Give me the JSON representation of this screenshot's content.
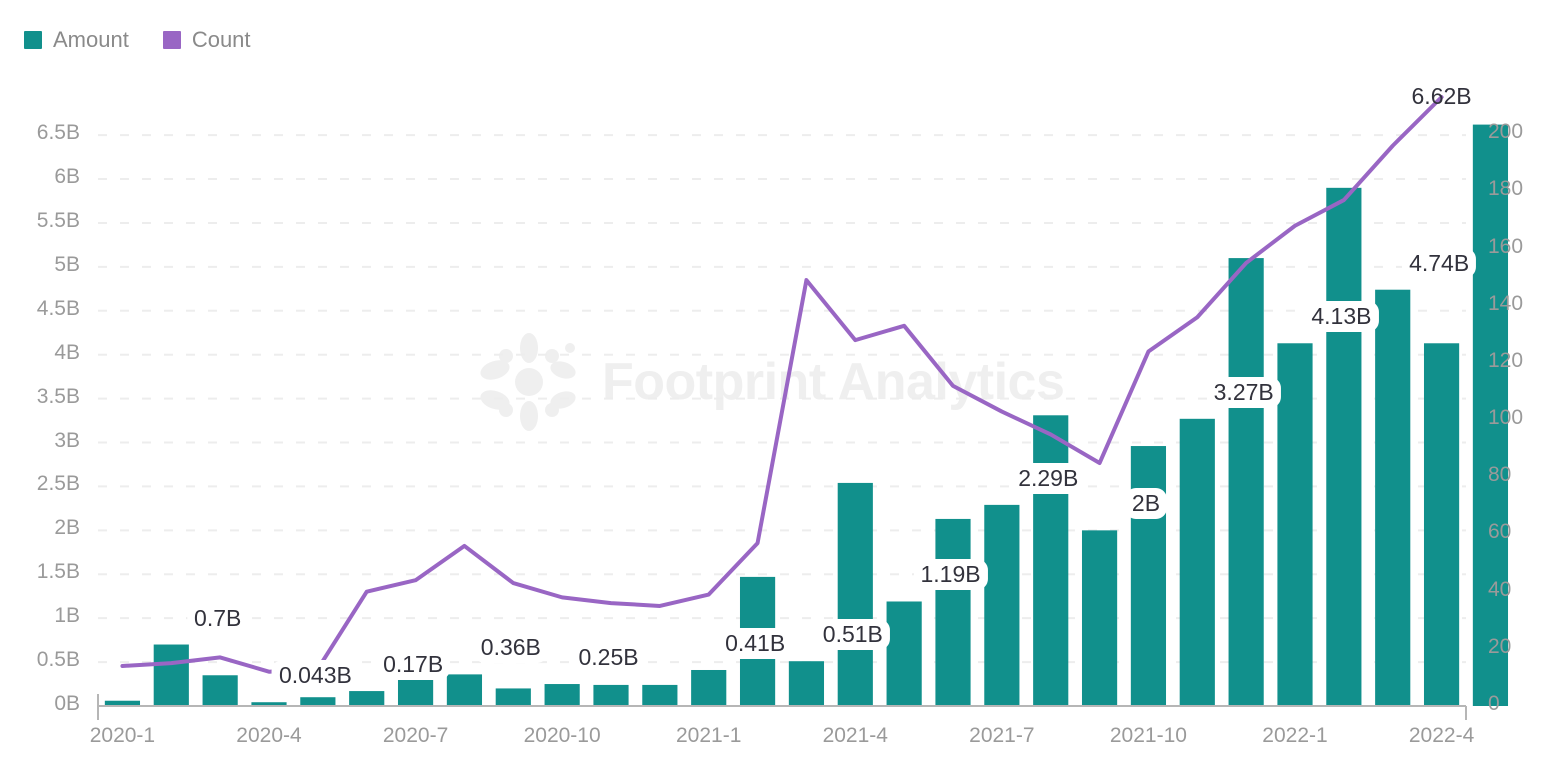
{
  "legend": {
    "items": [
      {
        "label": "Amount",
        "color": "#11908c",
        "name": "legend-item-amount"
      },
      {
        "label": "Count",
        "color": "#9966c4",
        "name": "legend-item-count"
      }
    ]
  },
  "watermark": {
    "text": "Footprint Analytics",
    "color": "#efefef"
  },
  "chart_data": {
    "type": "bar",
    "title": "",
    "subtitle": "",
    "xlabel": "",
    "ylabel": "",
    "grid": true,
    "legend_position": "top-left",
    "x": [
      "2020-1",
      "2020-2",
      "2020-3",
      "2020-4",
      "2020-5",
      "2020-6",
      "2020-7",
      "2020-8",
      "2020-9",
      "2020-10",
      "2020-11",
      "2020-12",
      "2021-1",
      "2021-2",
      "2021-3",
      "2021-4",
      "2021-5",
      "2021-6",
      "2021-7",
      "2021-8",
      "2021-9",
      "2021-10",
      "2021-11",
      "2021-12",
      "2022-1",
      "2022-2",
      "2022-3",
      "2022-4"
    ],
    "xtick_labels": [
      "2020-1",
      "2020-4",
      "2020-7",
      "2020-10",
      "2021-1",
      "2021-4",
      "2021-7",
      "2021-10",
      "2022-1",
      "2022-4"
    ],
    "xtick_indices": [
      0,
      3,
      6,
      9,
      12,
      15,
      18,
      21,
      24,
      27
    ],
    "ylim": [
      0,
      6.9
    ],
    "ytick_labels": [
      "0B",
      "0.5B",
      "1B",
      "1.5B",
      "2B",
      "2.5B",
      "3B",
      "3.5B",
      "4B",
      "4.5B",
      "5B",
      "5.5B",
      "6B",
      "6.5B"
    ],
    "ytick_values": [
      0,
      0.5,
      1,
      1.5,
      2,
      2.5,
      3,
      3.5,
      4,
      4.5,
      5,
      5.5,
      6,
      6.5
    ],
    "y2lim": [
      0,
      212
    ],
    "y2tick_labels": [
      "0",
      "20",
      "40",
      "60",
      "80",
      "100",
      "120",
      "140",
      "160",
      "180",
      "200"
    ],
    "y2tick_values": [
      0,
      20,
      40,
      60,
      80,
      100,
      120,
      140,
      160,
      180,
      200
    ],
    "series": [
      {
        "name": "Amount",
        "type": "bar",
        "axis": "left",
        "color": "#11908c",
        "unit": "B",
        "values": [
          0.06,
          0.7,
          0.35,
          0.043,
          0.1,
          0.17,
          0.6,
          0.36,
          0.2,
          0.25,
          0.24,
          0.24,
          0.41,
          1.47,
          0.51,
          2.54,
          1.19,
          2.13,
          2.29,
          3.31,
          2.0,
          2.96,
          3.27,
          5.1,
          4.13,
          5.9,
          4.74,
          4.13
        ],
        "labels": [
          {
            "index": 1,
            "text": "0.7B"
          },
          {
            "index": 3,
            "text": "0.043B"
          },
          {
            "index": 5,
            "text": "0.17B"
          },
          {
            "index": 7,
            "text": "0.36B"
          },
          {
            "index": 9,
            "text": "0.25B"
          },
          {
            "index": 12,
            "text": "0.41B"
          },
          {
            "index": 14,
            "text": "0.51B"
          },
          {
            "index": 16,
            "text": "1.19B"
          },
          {
            "index": 18,
            "text": "2.29B"
          },
          {
            "index": 20,
            "text": "2B"
          },
          {
            "index": 22,
            "text": "3.27B"
          },
          {
            "index": 24,
            "text": "4.13B"
          },
          {
            "index": 26,
            "text": "4.74B"
          }
        ]
      },
      {
        "name": "Count",
        "type": "line",
        "axis": "right",
        "color": "#9966c4",
        "values": [
          14,
          15,
          17,
          12,
          13,
          40,
          44,
          56,
          43,
          38,
          36,
          35,
          39,
          57,
          149,
          128,
          133,
          112,
          103,
          95,
          85,
          124,
          136,
          155,
          168,
          177,
          196,
          213
        ]
      }
    ],
    "final_bar_label": {
      "index": 27,
      "text": "6.62B",
      "value": 6.62
    }
  }
}
